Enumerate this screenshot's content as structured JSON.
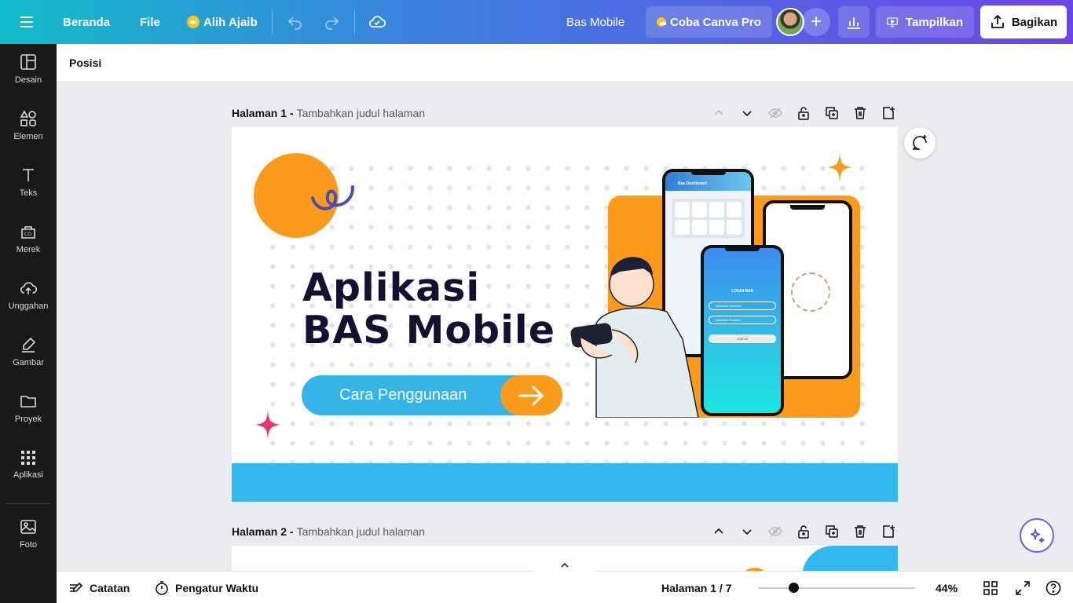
{
  "topbar": {
    "menu_icon": "hamburger-icon",
    "home": "Beranda",
    "file": "File",
    "magic_resize": "Alih Ajaib",
    "doc_title": "Bas Mobile",
    "try_pro": "Coba Canva Pro",
    "present": "Tampilkan",
    "share": "Bagikan"
  },
  "sidebar": {
    "items": [
      {
        "label": "Desain",
        "icon": "layout-icon"
      },
      {
        "label": "Elemen",
        "icon": "shapes-icon"
      },
      {
        "label": "Teks",
        "icon": "text-icon"
      },
      {
        "label": "Merek",
        "icon": "brand-icon"
      },
      {
        "label": "Unggahan",
        "icon": "upload-cloud-icon"
      },
      {
        "label": "Gambar",
        "icon": "draw-icon"
      },
      {
        "label": "Proyek",
        "icon": "folder-icon"
      },
      {
        "label": "Aplikasi",
        "icon": "apps-grid-icon"
      },
      {
        "label": "Foto",
        "icon": "photo-icon"
      }
    ]
  },
  "context_bar": {
    "position": "Posisi"
  },
  "pages": [
    {
      "title": "Halaman 1 -",
      "subtitle": "Tambahkan judul halaman"
    },
    {
      "title": "Halaman 2 -",
      "subtitle": "Tambahkan judul halaman"
    }
  ],
  "design": {
    "headline_line1": "Aplikasi",
    "headline_line2": "BAS Mobile",
    "cta_label": "Cara Penggunaan",
    "phone1_header": "Bas Dashboard",
    "phone3_title": "LOGIN BAS",
    "phone3_field1": "Masukkan Username",
    "phone3_field2": "Masukkan Password",
    "phone3_button": "LOG IN",
    "colors": {
      "orange": "#fc9a1c",
      "blue": "#33b8ed",
      "navy": "#14102f",
      "pink": "#e8336b"
    }
  },
  "bottombar": {
    "notes": "Catatan",
    "timer": "Pengatur Waktu",
    "page_indicator": "Halaman 1 / 7",
    "zoom": "44%",
    "zoom_level": 0.44
  }
}
